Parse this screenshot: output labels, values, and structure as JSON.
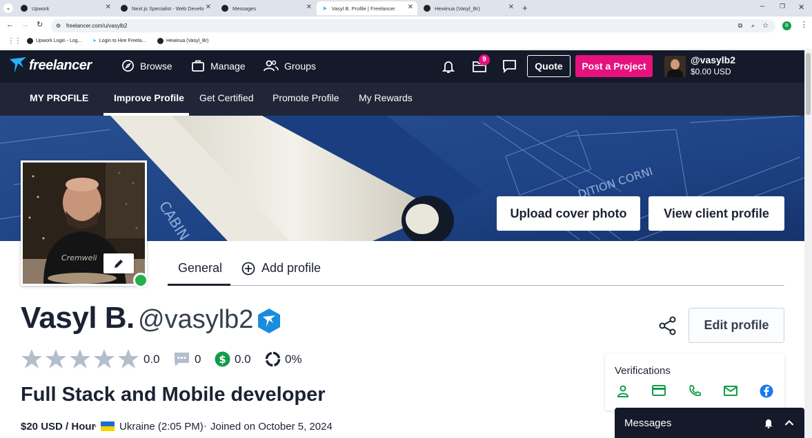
{
  "browser": {
    "tabs": [
      {
        "label": "Upwork"
      },
      {
        "label": "Next.js Specialist - Web Develo"
      },
      {
        "label": "Messages"
      },
      {
        "label": "Vasyl B. Profile | Freelancer"
      },
      {
        "label": "Hewinua (Vasyl_Br)"
      }
    ],
    "url": "freelancer.com/u/vasylb2",
    "profile_initial": "B",
    "bookmarks": [
      {
        "label": "Upwork Login - Log..."
      },
      {
        "label": "Login to Hire Freela..."
      },
      {
        "label": "Hewinua (Vasyl_Br)"
      }
    ]
  },
  "header": {
    "logo": "freelancer",
    "nav": {
      "browse": "Browse",
      "manage": "Manage",
      "groups": "Groups"
    },
    "projects_badge": "9",
    "quote": "Quote",
    "post_project": "Post a Project",
    "username": "@vasylb2",
    "balance": "$0.00 USD"
  },
  "subnav": {
    "my_profile": "MY PROFILE",
    "improve": "Improve Profile",
    "certified": "Get Certified",
    "promote": "Promote Profile",
    "rewards": "My Rewards"
  },
  "cover": {
    "upload": "Upload cover photo",
    "view_client": "View client profile"
  },
  "tabs": {
    "general": "General",
    "add_profile": "Add profile"
  },
  "profile": {
    "name": "Vasyl B.",
    "handle": "@vasylb2",
    "rating": "0.0",
    "reviews": "0",
    "earnings": "0.0",
    "completion": "0%",
    "headline": "Full Stack and Mobile developer",
    "rate": "$20 USD / Hour",
    "location": "Ukraine (2:05 PM)",
    "joined": "Joined on October 5, 2024",
    "edit": "Edit profile"
  },
  "verifications": {
    "title": "Verifications"
  },
  "messages": {
    "title": "Messages"
  },
  "colors": {
    "brand_blue": "#29b2fe",
    "post_pink": "#e5127d",
    "online_green": "#22b14c",
    "verify_green": "#139c49",
    "facebook_blue": "#1877f2"
  }
}
